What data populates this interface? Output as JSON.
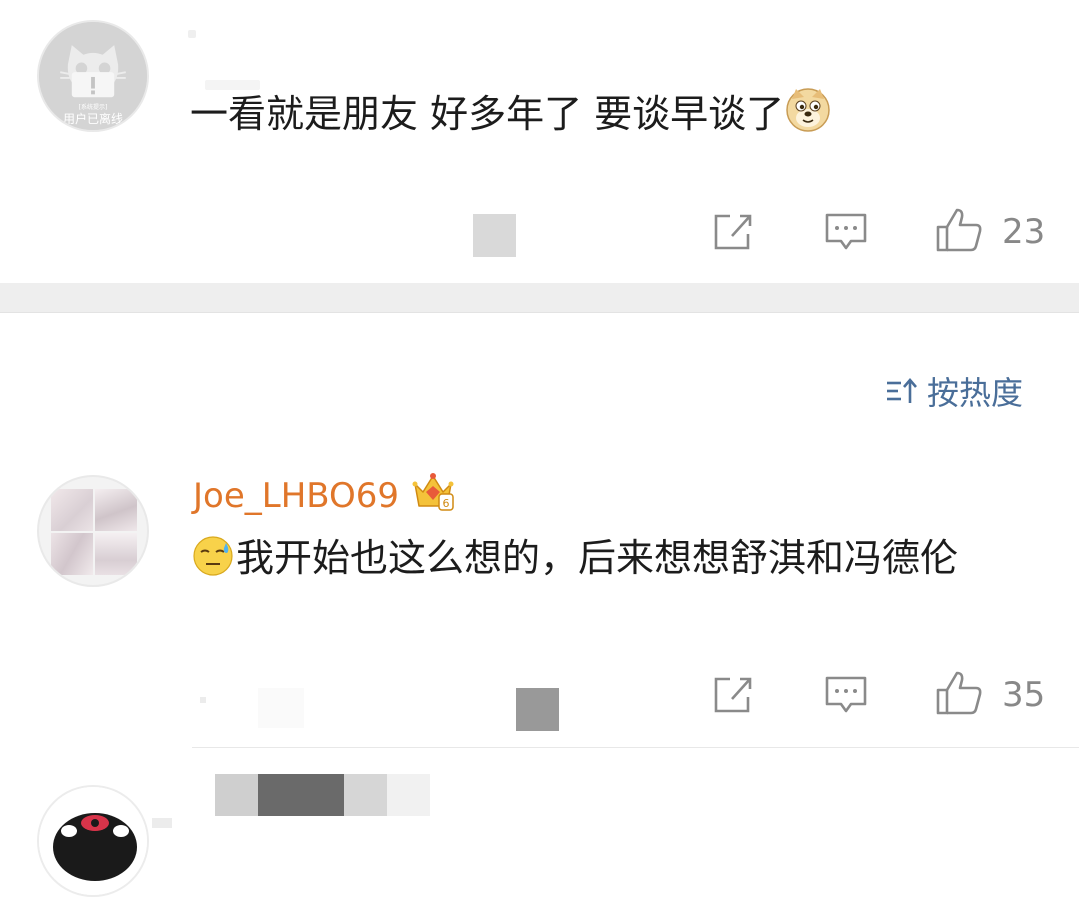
{
  "comments": [
    {
      "avatar_caption_small": "[系统提示]",
      "avatar_caption": "用户已离线",
      "text": "一看就是朋友  好多年了 要谈早谈了",
      "emoji": "doge-icon",
      "likes": "23"
    },
    {
      "username": "Joe_LHBO69",
      "badge": "vip-crown-icon",
      "emoji": "sweat-face-icon",
      "text": "我开始也这么想的，后来想想舒淇和冯德伦",
      "likes": "35"
    }
  ],
  "sort": {
    "label": "按热度",
    "icon": "sort-icon"
  },
  "colors": {
    "username": "#e0762a",
    "sort": "#4a6e99",
    "separator": "#eeeeee",
    "text": "#1c1c1c",
    "icon": "#8a8a8a"
  }
}
